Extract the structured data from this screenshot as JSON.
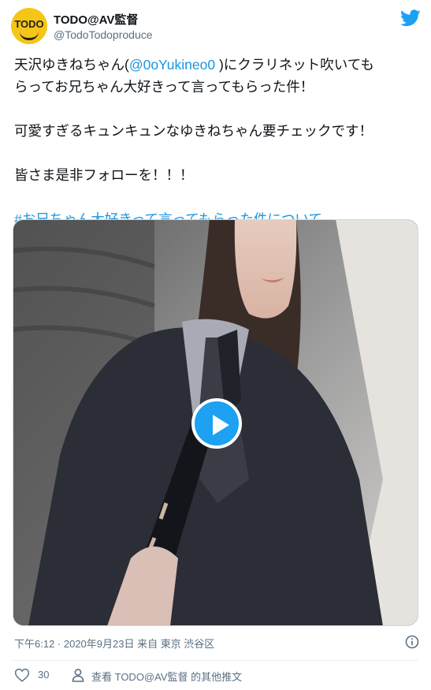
{
  "author": {
    "name": "TODO@AV監督",
    "handle": "@TodoTodoproduce",
    "avatar_text": "TODO"
  },
  "tweet": {
    "line1_a": "天沢ゆきねちゃん(",
    "mention": "@0oYukineo0",
    "line1_b": " )にクラリネット吹いても",
    "line2": "らってお兄ちゃん大好きって言ってもらった件！",
    "line3": "可愛すぎるキュンキュンなゆきねちゃん要チェックです！",
    "line4": "皆さま是非フォローを！！！",
    "hashtag": "#お兄ちゃん大好きって言ってもらった件について"
  },
  "meta": {
    "time": "下午6:12 · 2020年9月23日 来自 東京 渋谷区"
  },
  "actions": {
    "likes": "30",
    "more_text": "查看 TODO@AV監督 的其他推文"
  },
  "colors": {
    "accent": "#1da1f2",
    "link": "#1b95e0",
    "secondary_text": "#5b7083"
  }
}
